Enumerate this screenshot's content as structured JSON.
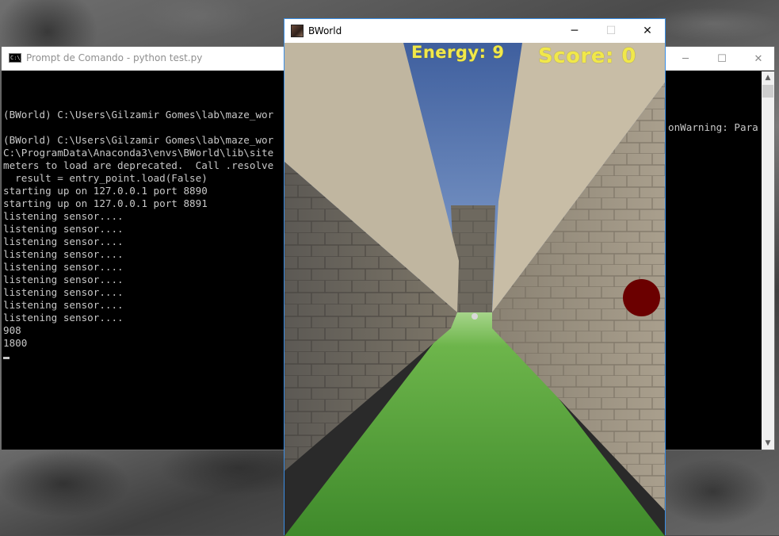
{
  "console": {
    "title": "Prompt de Comando - python  test.py",
    "icon": "cmd-icon",
    "icon_text": "C:\\.",
    "lines": [
      "(BWorld) C:\\Users\\Gilzamir Gomes\\lab\\maze_wor",
      "",
      "(BWorld) C:\\Users\\Gilzamir Gomes\\lab\\maze_wor",
      "C:\\ProgramData\\Anaconda3\\envs\\BWorld\\lib\\site",
      "meters to load are deprecated.  Call .resolve",
      "  result = entry_point.load(False)",
      "starting up on 127.0.0.1 port 8890",
      "starting up on 127.0.0.1 port 8891",
      "listening sensor....",
      "listening sensor....",
      "listening sensor....",
      "listening sensor....",
      "listening sensor....",
      "listening sensor....",
      "listening sensor....",
      "listening sensor....",
      "listening sensor....",
      "908",
      "1800"
    ],
    "right_fragment": "onWarning: Para",
    "buttons": {
      "minimize": "─",
      "maximize": "☐",
      "close": "✕"
    },
    "scroll": {
      "up": "▲",
      "down": "▼"
    }
  },
  "bworld": {
    "title": "BWorld",
    "buttons": {
      "minimize": "─",
      "maximize": "☐",
      "close": "✕"
    },
    "hud": {
      "energy_label": "Energy: 9",
      "score_label": "Score: 0"
    },
    "colors": {
      "hud_text": "#f1e84a",
      "target": "#6b0000",
      "sky": "#4a6fae",
      "grass": "#4f9a35",
      "wall": "#8f8779"
    }
  }
}
